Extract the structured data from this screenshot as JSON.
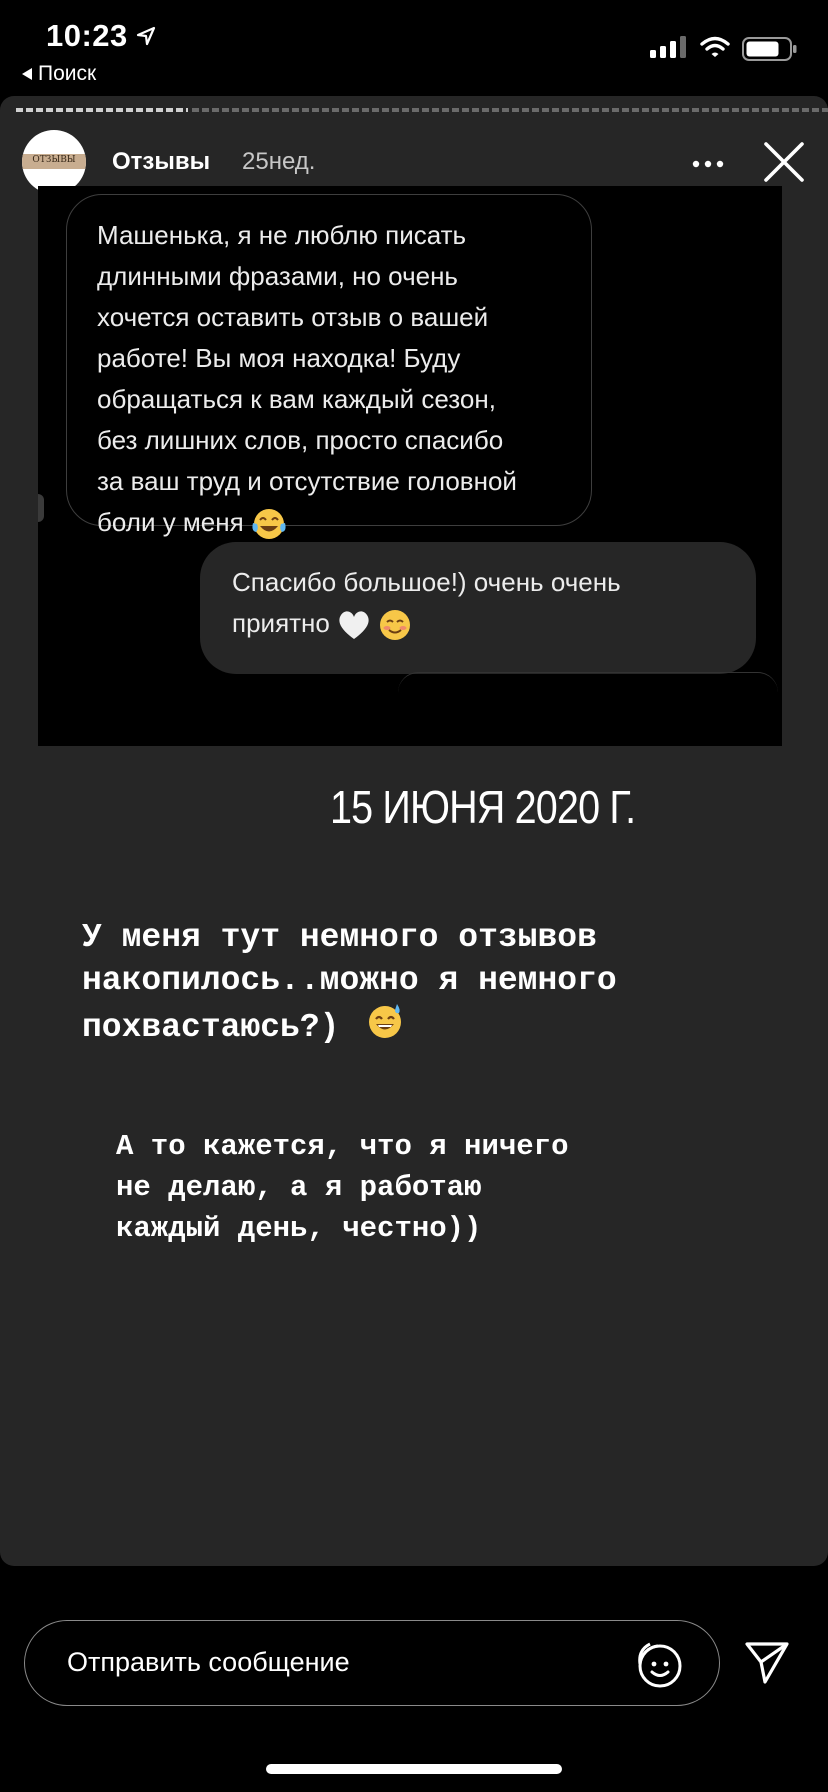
{
  "status_bar": {
    "time": "10:23",
    "back_label": "Поиск",
    "location_icon": "location-arrow-icon",
    "signal_icon": "cellular-signal-icon",
    "wifi_icon": "wifi-icon",
    "battery_icon": "battery-icon"
  },
  "story": {
    "progress_segments": 2,
    "active_segment": 1,
    "avatar_label": "ОТЗЫВЫ",
    "username": "Отзывы",
    "time_ago": "25нед.",
    "more_icon": "more-dots-icon",
    "close_icon": "close-icon"
  },
  "screenshot": {
    "incoming_lines": [
      "Машенька, я не люблю писать",
      "длинными фразами, но очень",
      "хочется оставить отзыв о вашей",
      "работе! Вы моя находка! Буду",
      "обращаться к вам каждый сезон,",
      "без лишних слов, просто спасибо",
      "за ваш труд и отсутствие головной",
      "боли у меня"
    ],
    "incoming_emoji": "tears-of-joy-emoji",
    "outgoing_lines": [
      "Спасибо большое!) очень очень",
      "приятно"
    ],
    "outgoing_emojis": [
      "white-heart-emoji",
      "smiling-blush-emoji"
    ]
  },
  "text": {
    "date": "15 ИЮНЯ 2020 Г.",
    "paragraph1": "У меня тут немного отзывов\nнакопилось..можно я немного\nпохвастаюсь?)",
    "paragraph1_emoji": "sweat-smile-emoji",
    "paragraph2": "А то кажется, что я ничего\nне делаю, а я работаю\nкаждый день, честно))"
  },
  "reply_bar": {
    "placeholder": "Отправить сообщение",
    "sticker_icon": "sticker-face-icon",
    "send_icon": "send-paper-plane-icon"
  }
}
